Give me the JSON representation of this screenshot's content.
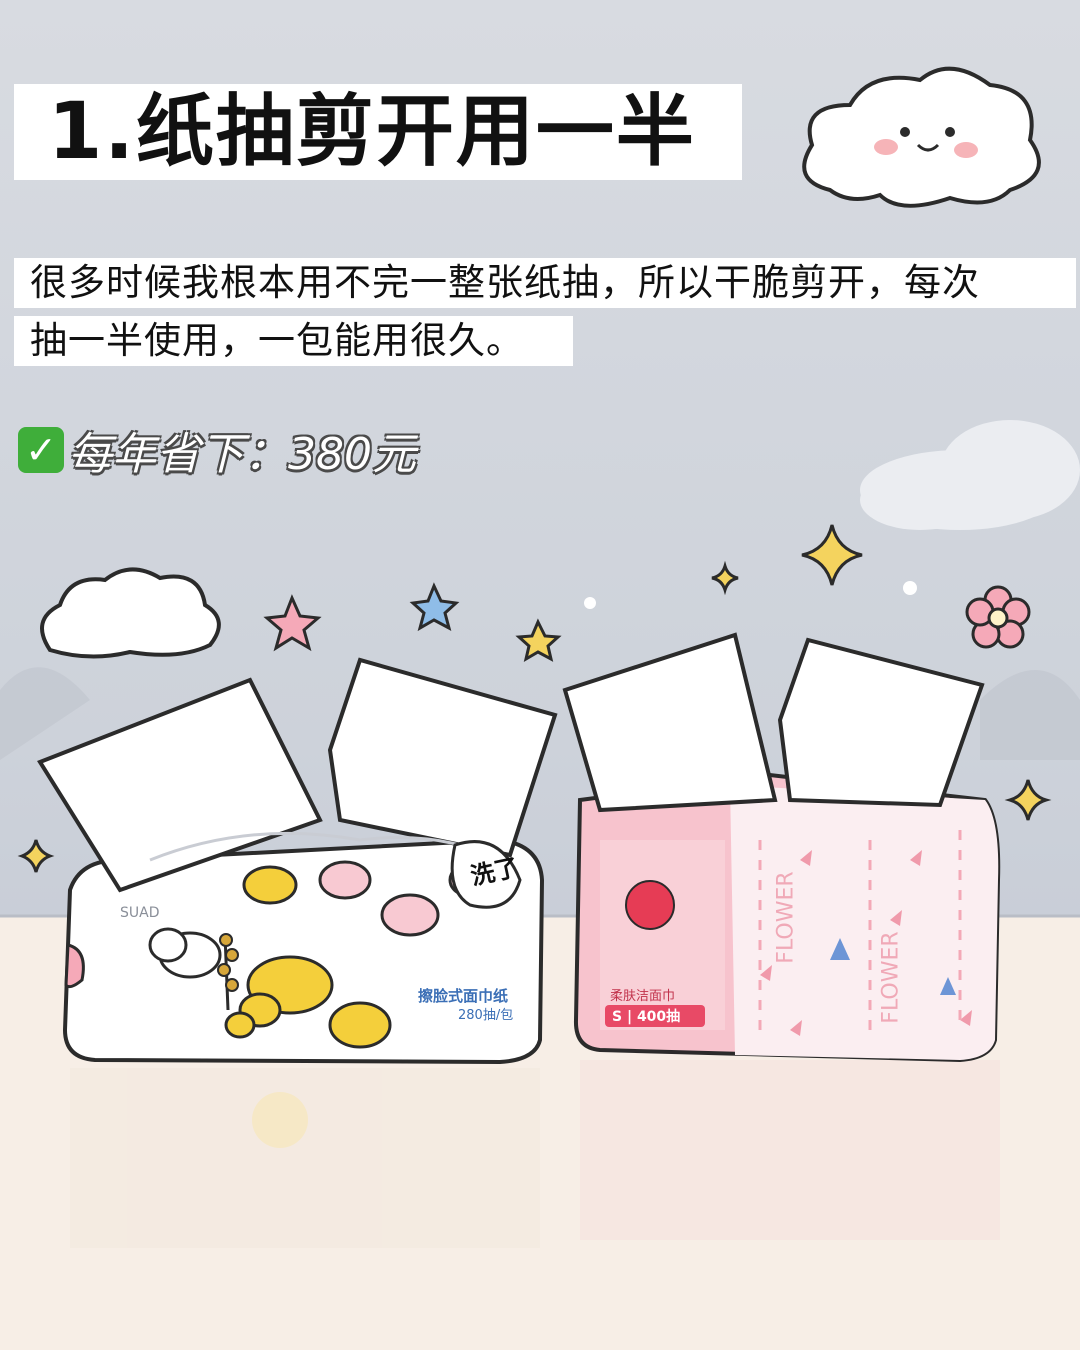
{
  "title": "1.纸抽剪开用一半",
  "body": {
    "line1": "很多时候我根本用不完一整张纸抽，所以干脆剪开，每次",
    "line2": "抽一半使用，一包能用很久。"
  },
  "saving": {
    "icon": "check-mark-icon",
    "text": "每年省下：380元"
  },
  "left_pack": {
    "badge": "洗了",
    "brand": "SUAD",
    "product": "擦脸式面巾纸",
    "count": "280抽/包"
  },
  "right_pack": {
    "product": "柔肤洁面巾",
    "count": "S | 400抽",
    "pattern_word_1": "FLOWER",
    "pattern_word_2": "FLOWER"
  },
  "colors": {
    "sky": "#d3d7de",
    "table": "#f6ede5",
    "pink_pack": "#f7cad3",
    "flower_yellow": "#f4cf3b"
  }
}
